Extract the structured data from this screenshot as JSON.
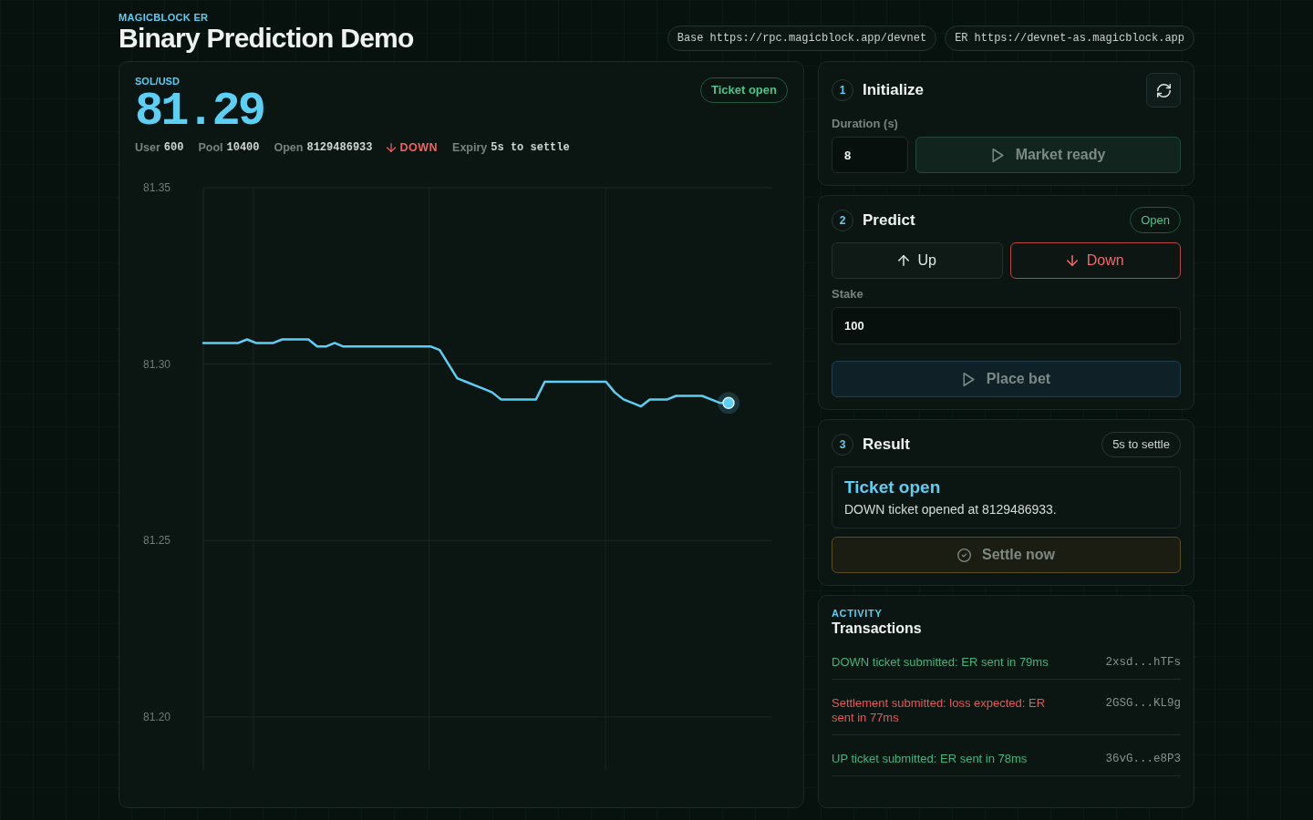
{
  "header": {
    "eyebrow": "MAGICBLOCK ER",
    "title": "Binary Prediction Demo",
    "endpoints": [
      {
        "label": "Base",
        "url": "https://rpc.magicblock.app/devnet"
      },
      {
        "label": "ER",
        "url": "https://devnet-as.magicblock.app"
      }
    ]
  },
  "market": {
    "pair": "SOL/USD",
    "price": "81.29",
    "status": "Ticket open",
    "stats": [
      {
        "kind": "field",
        "label": "User",
        "value": "600"
      },
      {
        "kind": "field",
        "label": "Pool",
        "value": "10400"
      },
      {
        "kind": "field",
        "label": "Open",
        "value": "8129486933"
      },
      {
        "kind": "down",
        "value": "DOWN"
      },
      {
        "kind": "field",
        "label": "Expiry",
        "value": "5s to settle"
      }
    ],
    "chart_data": [
      {
        "type": "line",
        "color": "#5ccff5",
        "ylim": [
          81.185,
          81.35
        ],
        "yticks": [
          {
            "value": 81.35,
            "label": "81.35"
          },
          {
            "value": 81.3,
            "label": "81.30"
          },
          {
            "value": 81.25,
            "label": "81.25"
          },
          {
            "value": 81.2,
            "label": "81.20"
          }
        ],
        "tick_labels": "y",
        "grid": true,
        "values": [
          81.306,
          81.306,
          81.306,
          81.306,
          81.306,
          81.307,
          81.306,
          81.306,
          81.306,
          81.307,
          81.307,
          81.307,
          81.307,
          81.305,
          81.305,
          81.306,
          81.305,
          81.305,
          81.305,
          81.305,
          81.305,
          81.305,
          81.305,
          81.305,
          81.305,
          81.305,
          81.305,
          81.304,
          81.3,
          81.296,
          81.295,
          81.294,
          81.293,
          81.292,
          81.29,
          81.29,
          81.29,
          81.29,
          81.29,
          81.295,
          81.295,
          81.295,
          81.295,
          81.295,
          81.295,
          81.295,
          81.295,
          81.292,
          81.29,
          81.289,
          81.288,
          81.29,
          81.29,
          81.29,
          81.291,
          81.291,
          81.291,
          81.291,
          81.29,
          81.289,
          81.289,
          null,
          null,
          null,
          null,
          null
        ]
      }
    ]
  },
  "initialize": {
    "step": "1",
    "title": "Initialize",
    "duration": {
      "label": "Duration (s)",
      "value": "8"
    },
    "action": {
      "label": "Market ready",
      "disabled": true
    }
  },
  "predict": {
    "step": "2",
    "title": "Predict",
    "status": "Open",
    "choices": [
      {
        "kind": "up",
        "label": "Up",
        "selected": false
      },
      {
        "kind": "down",
        "label": "Down",
        "selected": true
      }
    ],
    "stake": {
      "label": "Stake",
      "value": "100"
    },
    "action": {
      "label": "Place bet",
      "disabled": true
    }
  },
  "result": {
    "step": "3",
    "title": "Result",
    "status": "5s to settle",
    "outcome": {
      "title": "Ticket open",
      "message": "DOWN ticket opened at 8129486933."
    },
    "action": {
      "label": "Settle now",
      "disabled": true
    }
  },
  "activity": {
    "eyebrow": "ACTIVITY",
    "title": "Transactions",
    "rows": [
      {
        "text": "DOWN ticket submitted: ER sent in 79ms",
        "signature": "2xsd...hTFs",
        "color": "#3eb57c"
      },
      {
        "text": "Settlement submitted: loss expected: ER sent in 77ms",
        "signature": "2GSG...KL9g",
        "color": "#eb5757"
      },
      {
        "text": "UP ticket submitted: ER sent in 78ms",
        "signature": "36vG...e8P3",
        "color": "#3eb57c"
      }
    ]
  }
}
